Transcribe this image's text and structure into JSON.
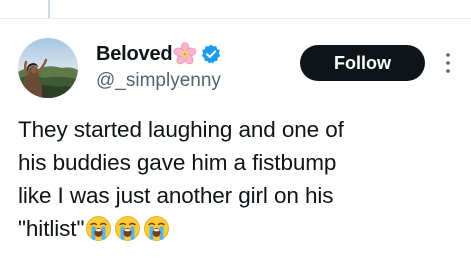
{
  "author": {
    "display_name": "Beloved",
    "handle": "@_simplyenny",
    "name_emoji_icon": "cherry-blossom-icon",
    "verified_icon": "verified-badge-icon"
  },
  "follow_button": {
    "label": "Follow"
  },
  "tweet": {
    "lines": [
      "They started laughing and one of",
      "his buddies gave him a fistbump",
      "like I was just another girl on his",
      "\"hitlist\""
    ],
    "trailing_emoji_icon": "loudly-crying-face-icon",
    "trailing_emoji_count": 3
  },
  "colors": {
    "text": "#0f1419",
    "secondary_text": "#536471",
    "verified_blue": "#1d9bf0",
    "button_bg": "#0f1419",
    "button_text": "#ffffff",
    "divider": "#e6ecf0"
  }
}
